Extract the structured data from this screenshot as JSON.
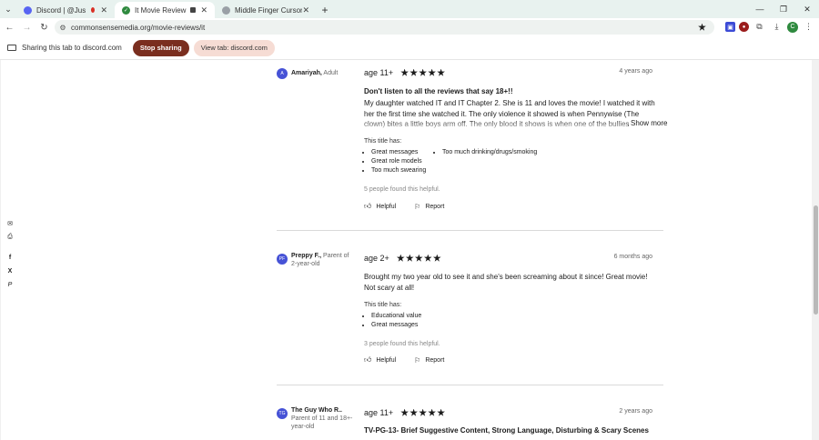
{
  "browser": {
    "tabs": [
      {
        "title": "Discord | @Just a Fox",
        "active": false
      },
      {
        "title": "It Movie Review | Common",
        "active": true
      },
      {
        "title": "Middle Finger Cursor",
        "active": false
      }
    ],
    "url": "commonsensemedia.org/movie-reviews/it",
    "avatar_letter": "C"
  },
  "sharebar": {
    "text": "Sharing this tab to discord.com",
    "stop_label": "Stop sharing",
    "view_label": "View tab: discord.com"
  },
  "social_icons": [
    "email-icon",
    "print-icon",
    "facebook-icon",
    "x-icon",
    "pinterest-icon"
  ],
  "social_glyphs": {
    "email": "✉",
    "print": "⎙",
    "facebook": "f",
    "x": "X",
    "pinterest": "P"
  },
  "reviews": [
    {
      "initials": "A",
      "name": "Amariyah,",
      "role": " Adult",
      "age": "age 11+",
      "stars": 5,
      "date": "4 years ago",
      "title": "Don't listen to all the reviews that say 18+!!",
      "body": "My daughter watched IT and IT Chapter 2. She is 11 and loves the movie! I watched it with her the first time she watched it. The only violence it showed is when Pennywise (The clown) bites a little boys arm off. The only blood it shows is when one of the bullies kills his dad. As for the sw",
      "show_more": "Show more",
      "has_label": "This title has:",
      "has_col1": [
        "Great messages",
        "Great role models",
        "Too much swearing"
      ],
      "has_col2": [
        "Too much drinking/drugs/smoking"
      ],
      "helpful_text": "5 people found this helpful.",
      "helpful_label": "Helpful",
      "report_label": "Report"
    },
    {
      "initials": "PF",
      "name": "Preppy F.,",
      "role": " Parent of 2-year-old",
      "age": "age 2+",
      "stars": 5,
      "date": "6 months ago",
      "body": "Brought my two year old to see it and she's been screaming about it since! Great movie! Not scary at all!",
      "has_label": "This title has:",
      "has_col1": [
        "Educational value",
        "Great messages"
      ],
      "helpful_text": "3 people found this helpful.",
      "helpful_label": "Helpful",
      "report_label": "Report"
    },
    {
      "initials": "TG",
      "name": "The Guy Who R..",
      "role": " Parent of 11 and 18+-year-old",
      "age": "age 11+",
      "stars": 5,
      "date": "2 years ago",
      "title": "TV-PG-13- Brief Suggestive Content, Strong Language, Disturbing & Scary Scenes"
    }
  ]
}
